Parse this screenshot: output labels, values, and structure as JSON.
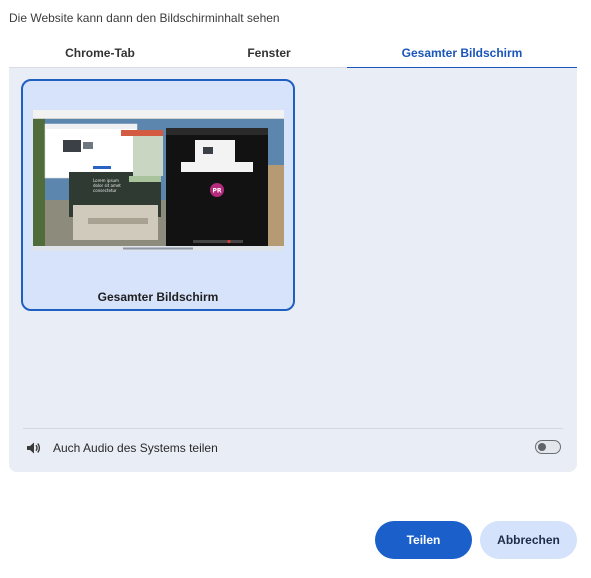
{
  "dialog": {
    "subtitle": "Die Website kann dann den Bildschirminhalt sehen"
  },
  "tabs": [
    {
      "label": "Chrome-Tab",
      "selected": false
    },
    {
      "label": "Fenster",
      "selected": false
    },
    {
      "label": "Gesamter Bildschirm",
      "selected": true
    }
  ],
  "sources": [
    {
      "label": "Gesamter Bildschirm",
      "selected": true,
      "thumbnail_avatar": "PR"
    }
  ],
  "audio": {
    "label": "Auch Audio des Systems teilen",
    "icon": "speaker-icon",
    "enabled": false
  },
  "buttons": {
    "share": "Teilen",
    "cancel": "Abbrechen"
  },
  "colors": {
    "accent": "#1a56b8",
    "panel": "#e9edf5",
    "selected_card": "#d7e3fb"
  }
}
